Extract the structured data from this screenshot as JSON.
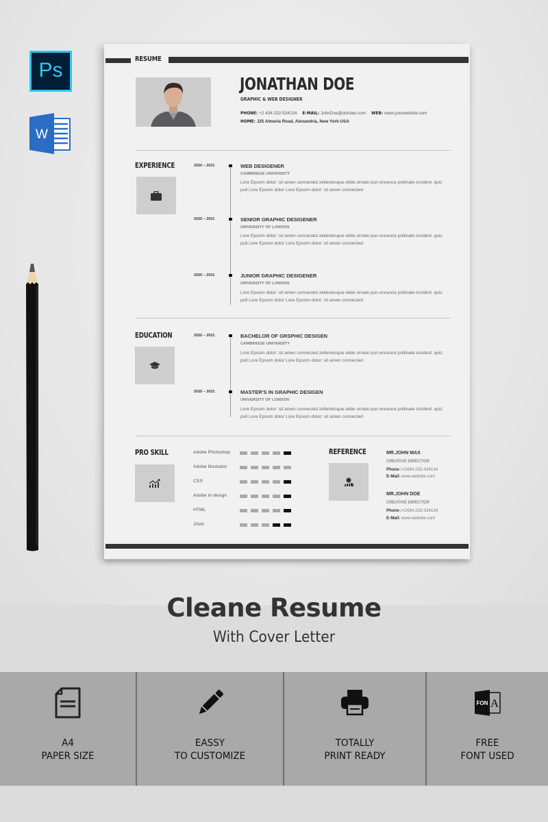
{
  "app_icons": [
    {
      "name": "photoshop-icon",
      "label": "Ps",
      "color": "#31c5f0",
      "bg": "#001e36"
    },
    {
      "name": "word-icon",
      "label": "W",
      "color": "#2b6cc4"
    }
  ],
  "resume": {
    "header_label": "RESUME",
    "name": "JONATHAN DOE",
    "role": "GRAPHIC & WEB DESIGNER",
    "contact": {
      "phone_label": "PHONE:",
      "phone": "+2 434-232-534234",
      "email_label": "E-MAIL:",
      "email": "JohnDoe@domain.com",
      "web_label": "WEB:",
      "web": "www.yourwebsite.com",
      "home_label": "HOME:",
      "home": "J25 Almeria Road, Alexandria, New York-USA"
    },
    "experience": {
      "title": "EXPERIENCE",
      "icon": "briefcase-icon",
      "items": [
        {
          "date": "2020 – 2021",
          "title": "WEB DESIGENER",
          "org": "CAMBRIDGE UNIVERSITY",
          "desc": "Lore Epsom dolor: sit amen connected zellentesque elide ornate pun enounce pollinate incident. quiz pull Lore Epsom dolor Lore Epsom dolor: sit amen connected"
        },
        {
          "date": "2020 – 2021",
          "title": "SENIOR GRAPHIC DESIGENER",
          "org": "UNIVERSITY OF LONDON",
          "desc": "Lore Epsom dolor: sit amen connected zellentesque elide ornate pun enounce pollinate incident. quiz pull Lore Epsom dolor Lore Epsom dolor: sit amen connected"
        },
        {
          "date": "2020 – 2021",
          "title": "JUNIOR GRAPHIC DESIGENER",
          "org": "UNIVERSITY OF LONDON",
          "desc": "Lore Epsom dolor: sit amen connected zellentesque elide ornate pun enounce pollinate incident. quiz pull Lore Epsom dolor Lore Epsom dolor: sit amen connected"
        }
      ]
    },
    "education": {
      "title": "EDUCATION",
      "icon": "graduation-cap-icon",
      "items": [
        {
          "date": "2020 – 2021",
          "title": "BACHELOR OF GRSPHIC DESIGEN",
          "org": "CAMBRIDGE UNIVERSITY",
          "desc": "Lore Epsom dolor: sit amen connected zellentesque elide ornate pun enounce pollinate incident. quiz pull Lore Epsom dolor Lore Epsom dolor: sit amen connected"
        },
        {
          "date": "2020 – 2021",
          "title": "MASTER'S IN GRAPHIC DESIGEN",
          "org": "UNIVERSITY OF LONDON",
          "desc": "Lore Epsom dolor: sit amen connected zellentesque elide ornate pun enounce pollinate incident. quiz pull Lore Epsom dolor Lore Epsom dolor: sit amen connected"
        }
      ]
    },
    "skills": {
      "title": "PRO SKILL",
      "icon": "growth-chart-icon",
      "scale_max": 5,
      "items": [
        {
          "name": "Adobe Photoshop",
          "dark_blocks": 1
        },
        {
          "name": "Adobe Illustrator",
          "dark_blocks": 0
        },
        {
          "name": "CSS",
          "dark_blocks": 1
        },
        {
          "name": "Adobe In design",
          "dark_blocks": 1
        },
        {
          "name": "HTML",
          "dark_blocks": 1
        },
        {
          "name": "JAVA",
          "dark_blocks": 2
        }
      ]
    },
    "reference": {
      "title": "REFERENCE",
      "icon": "people-icon",
      "items": [
        {
          "name": "MR.JOHN MAX",
          "role": "CREATIVE DIRECTOR",
          "phone_label": "Phone :",
          "phone": "+2434-232-534134",
          "email_label": "E-Mail:",
          "email": "www.website.com"
        },
        {
          "name": "MR.JOHN DOE",
          "role": "CREATIVE DIRECTOR",
          "phone_label": "Phone :",
          "phone": "+2434-232-534134",
          "email_label": "E-Mail:",
          "email": "www.website.com"
        }
      ]
    }
  },
  "title": "Cleane Resume",
  "subtitle": "With Cover Letter",
  "features": [
    {
      "icon": "document-icon",
      "line1": "A4",
      "line2": "PAPER SIZE"
    },
    {
      "icon": "pencil-icon",
      "line1": "EASSY",
      "line2": "TO CUSTOMIZE"
    },
    {
      "icon": "printer-icon",
      "line1": "TOTALLY",
      "line2": "PRINT READY"
    },
    {
      "icon": "font-icon",
      "line1": "FREE",
      "line2": "FONT USED",
      "glyph_text": "FON",
      "glyph_letter": "A"
    }
  ]
}
